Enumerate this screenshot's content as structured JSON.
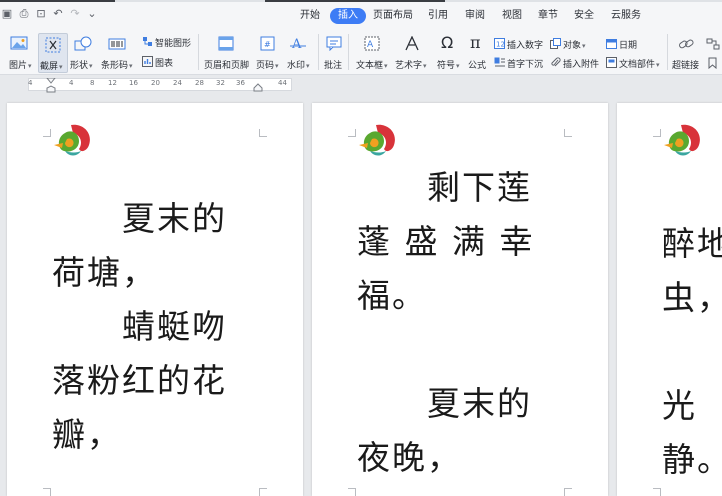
{
  "menu_tabs": [
    "开始",
    "插入",
    "页面布局",
    "引用",
    "审阅",
    "视图",
    "章节",
    "安全",
    "云服务"
  ],
  "active_tab": "插入",
  "ribbon": {
    "picture": "图片",
    "screenshot": "截屏",
    "shape": "形状",
    "barcode": "条形码",
    "smart_shape": "智能图形",
    "chart": "图表",
    "header_footer": "页眉和页脚",
    "page_number": "页码",
    "watermark": "水印",
    "comment": "批注",
    "textbox": "文本框",
    "wordart": "艺术字",
    "symbol": "符号",
    "formula": "公式",
    "insert_number": "插入数字",
    "object": "对象",
    "dropcap": "首字下沉",
    "attachment": "插入附件",
    "date": "日期",
    "doc_parts": "文档部件",
    "hyperlink": "超链接"
  },
  "ruler_numbers": [
    "4",
    "4",
    "8",
    "12",
    "16",
    "20",
    "24",
    "28",
    "32",
    "36",
    "44"
  ],
  "pages": [
    {
      "lines": [
        "　　夏末的",
        "荷塘，",
        "　　蜻蜓吻",
        "落粉红的花",
        "瓣，"
      ]
    },
    {
      "lines": [
        "　　剩下莲",
        "蓬 盛 满 幸",
        "福。",
        "",
        "　　夏末的",
        "夜晚，"
      ]
    },
    {
      "lines": [
        "醉地",
        "虫，",
        "",
        "光",
        "静。"
      ]
    }
  ],
  "colors": {
    "accent": "#3d7cf5",
    "logo_red": "#d8333a",
    "logo_green": "#5aa830",
    "logo_orange": "#f0a020"
  }
}
